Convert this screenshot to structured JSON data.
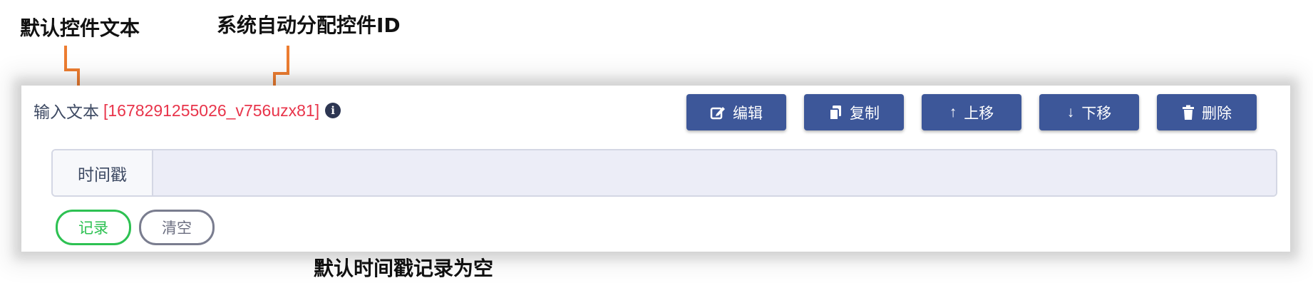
{
  "annotations": {
    "control_text": "默认控件文本",
    "auto_id": "系统自动分配控件ID",
    "empty_record": "默认时间戳记录为空"
  },
  "control": {
    "label": "输入文本",
    "id": "[1678291255026_v756uzx81]",
    "info_icon": "i"
  },
  "toolbar": {
    "edit": "编辑",
    "copy": "复制",
    "move_up": "上移",
    "move_down": "下移",
    "delete": "删除"
  },
  "input": {
    "label": "时间戳",
    "value": "",
    "placeholder": ""
  },
  "buttons": {
    "record": "记录",
    "clear": "清空"
  },
  "colors": {
    "annotation_arrow": "#ed7d31",
    "toolbar_button": "#3d5799",
    "control_id": "#e8344a",
    "record_button": "#2dc152",
    "clear_button": "#7a7d8f",
    "input_background": "#ecedf7"
  },
  "icons": {
    "edit": "edit-icon",
    "copy": "copy-icon",
    "move_up": "arrow-up-icon",
    "move_down": "arrow-down-icon",
    "delete": "trash-icon",
    "info": "info-icon"
  }
}
